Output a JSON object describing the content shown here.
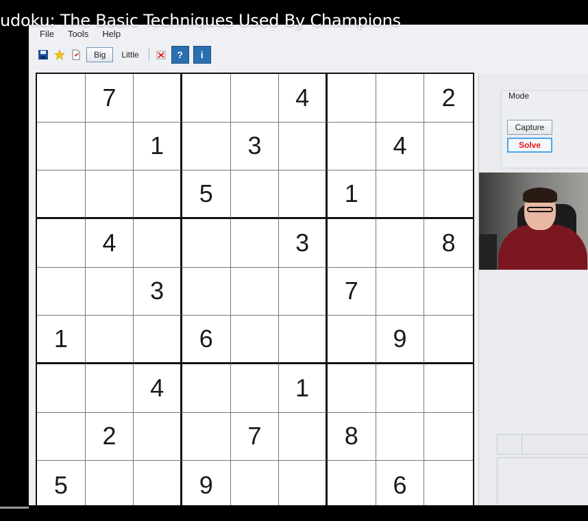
{
  "video": {
    "title": "udoku: The Basic Techniques Used By Champions"
  },
  "menu": [
    "File",
    "Tools",
    "Help"
  ],
  "toolbar": {
    "save_icon": "floppy-save-icon",
    "star_icon": "star-icon",
    "document_icon": "document-icon",
    "big_label": "Big",
    "little_label": "Little",
    "clear_icon": "clear-icon",
    "help_label": "?",
    "info_label": "i"
  },
  "board": {
    "grid": [
      [
        "",
        "7",
        "",
        "",
        "",
        "4",
        "",
        "",
        "2"
      ],
      [
        "",
        "",
        "1",
        "",
        "3",
        "",
        "",
        "4",
        ""
      ],
      [
        "",
        "",
        "",
        "5",
        "",
        "",
        "1",
        "",
        ""
      ],
      [
        "",
        "4",
        "",
        "",
        "",
        "3",
        "",
        "",
        "8"
      ],
      [
        "",
        "",
        "3",
        "",
        "",
        "",
        "7",
        "",
        ""
      ],
      [
        "1",
        "",
        "",
        "6",
        "",
        "",
        "",
        "9",
        ""
      ],
      [
        "",
        "",
        "4",
        "",
        "",
        "1",
        "",
        "",
        ""
      ],
      [
        "",
        "2",
        "",
        "",
        "7",
        "",
        "8",
        "",
        ""
      ],
      [
        "5",
        "",
        "",
        "9",
        "",
        "",
        "",
        "6",
        ""
      ]
    ]
  },
  "side_panel": {
    "mode_label": "Mode",
    "capture_label": "Capture",
    "solve_label": "Solve"
  },
  "colors": {
    "solve_text": "#e11111",
    "solve_border": "#4aa4e8",
    "toolbar_accent": "#2a6fb0"
  }
}
